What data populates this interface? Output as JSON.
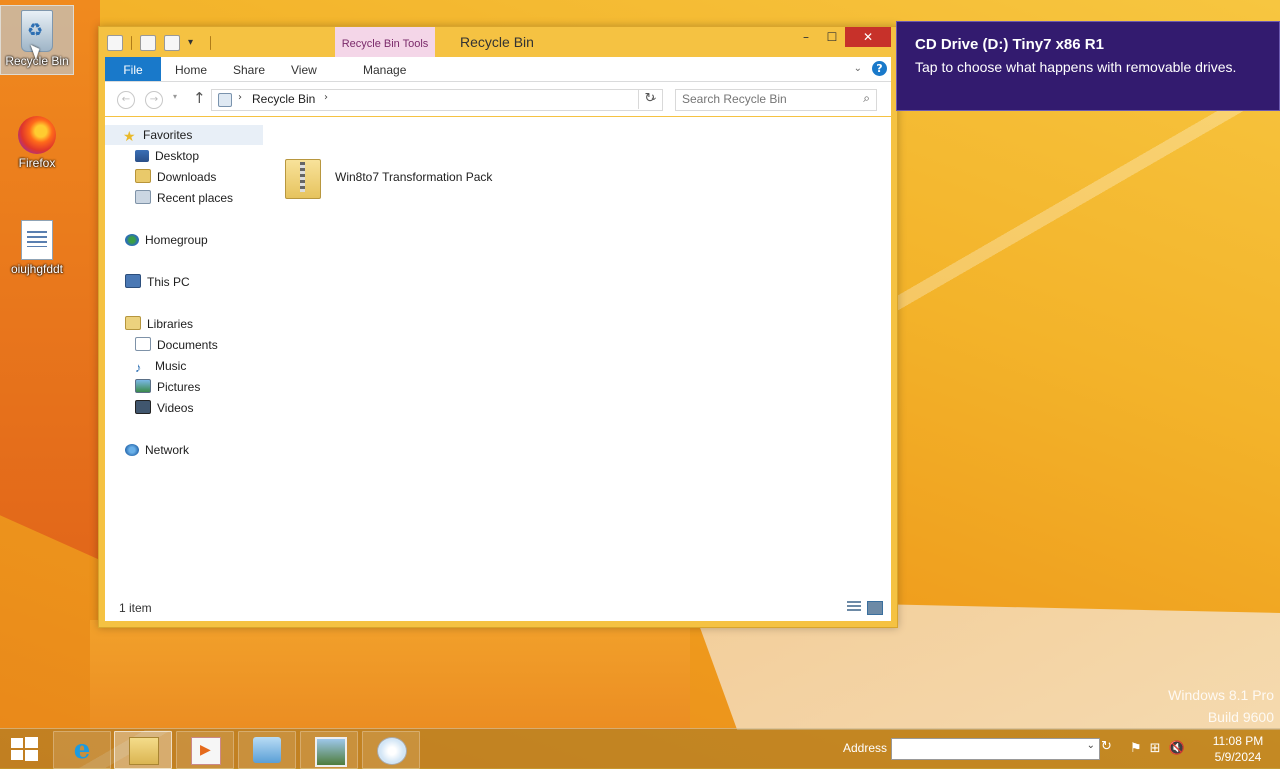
{
  "desktop": {
    "icons": [
      {
        "label": "Recycle Bin"
      },
      {
        "label": "Firefox"
      },
      {
        "label": "oiujhgfddt"
      }
    ]
  },
  "window": {
    "title": "Recycle Bin",
    "contextual_tab": "Recycle Bin Tools",
    "controls": {
      "minimize": "–",
      "maximize": "☐",
      "close": "✕"
    },
    "ribbon_tabs": [
      "File",
      "Home",
      "Share",
      "View",
      "Manage"
    ],
    "address": {
      "crumb": "Recycle Bin"
    },
    "search": {
      "placeholder": "Search Recycle Bin"
    },
    "nav": {
      "favorites": "Favorites",
      "desktop": "Desktop",
      "downloads": "Downloads",
      "recent": "Recent places",
      "homegroup": "Homegroup",
      "this_pc": "This PC",
      "libraries": "Libraries",
      "documents": "Documents",
      "music": "Music",
      "pictures": "Pictures",
      "videos": "Videos",
      "network": "Network"
    },
    "items": [
      {
        "name": "Win8to7 Transformation Pack"
      }
    ],
    "status": "1 item"
  },
  "toast": {
    "title": "CD Drive (D:) Tiny7 x86 R1",
    "body": "Tap to choose what happens with removable drives."
  },
  "watermark": {
    "line1": "Windows 8.1 Pro",
    "line2": "Build 9600"
  },
  "taskbar": {
    "address_label": "Address",
    "address_value": "",
    "time": "11:08 PM",
    "date": "5/9/2024"
  },
  "colors": {
    "accent": "#1979ca",
    "toast_bg": "#331b6f",
    "window_frame": "#f5c242",
    "close": "#c7312a"
  }
}
